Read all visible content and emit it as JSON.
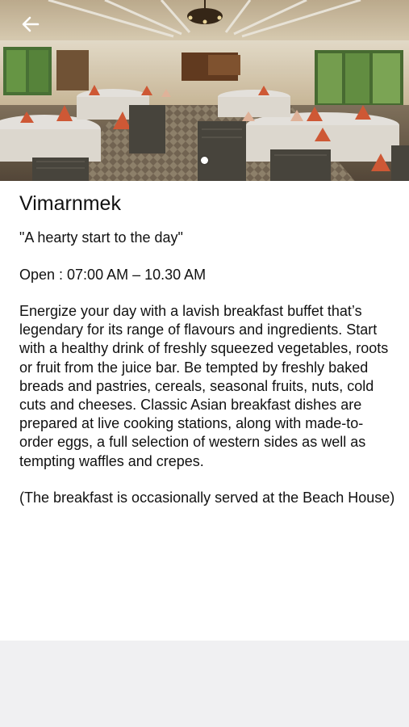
{
  "header": {
    "back_icon": "arrow-left-icon",
    "carousel": {
      "page_count": 1,
      "active_index": 0
    }
  },
  "restaurant": {
    "name": "Vimarnmek",
    "tagline": "\"A hearty start to the day\"",
    "hours": "Open : 07:00 AM – 10.30 AM",
    "description": "Energize your day with a lavish breakfast buffet that’s legendary for its range of flavours and ingredients. Start with a healthy drink of freshly squeezed vegetables, roots or fruit from the juice bar. Be tempted by freshly baked breads and pastries, cereals, seasonal fruits, nuts, cold cuts and cheeses. Classic Asian breakfast dishes are prepared at live cooking stations, along with made-to-order eggs, a full selection of western sides as well as tempting waffles and crepes.",
    "note": "(The breakfast is occasionally served at the Beach House)"
  },
  "colors": {
    "text": "#111111",
    "background": "#ffffff",
    "footer_band": "#f0f0f2",
    "napkin_accent": "#e0603a"
  }
}
